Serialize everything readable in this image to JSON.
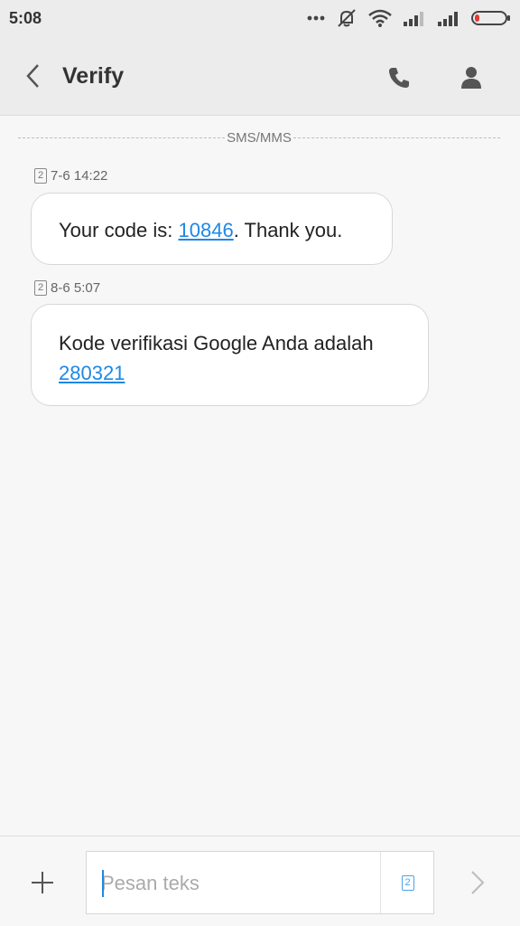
{
  "status_bar": {
    "time": "5:08",
    "icons": [
      "more-dots-icon",
      "mute-icon",
      "wifi-icon",
      "signal-icon",
      "signal-icon",
      "battery-icon"
    ]
  },
  "header": {
    "title": "Verify",
    "icons": [
      "chevron-left-icon",
      "phone-icon",
      "person-icon"
    ]
  },
  "divider": {
    "label": "SMS/MMS"
  },
  "messages": [
    {
      "sim": "2",
      "timestamp": "7-6 14:22",
      "text_before": "Your code is: ",
      "code": "10846",
      "text_after": ". Thank you."
    },
    {
      "sim": "2",
      "timestamp": "8-6 5:07",
      "text_before": "Kode verifikasi Google Anda adalah",
      "code": "280321",
      "text_after": ""
    }
  ],
  "composer": {
    "placeholder": "Pesan teks",
    "value": "",
    "sim": "2",
    "icons": [
      "plus-icon",
      "sim-icon",
      "send-arrow-icon"
    ]
  },
  "colors": {
    "accent": "#1e88e5",
    "background": "#f6f7f6",
    "bar": "#ececec"
  }
}
